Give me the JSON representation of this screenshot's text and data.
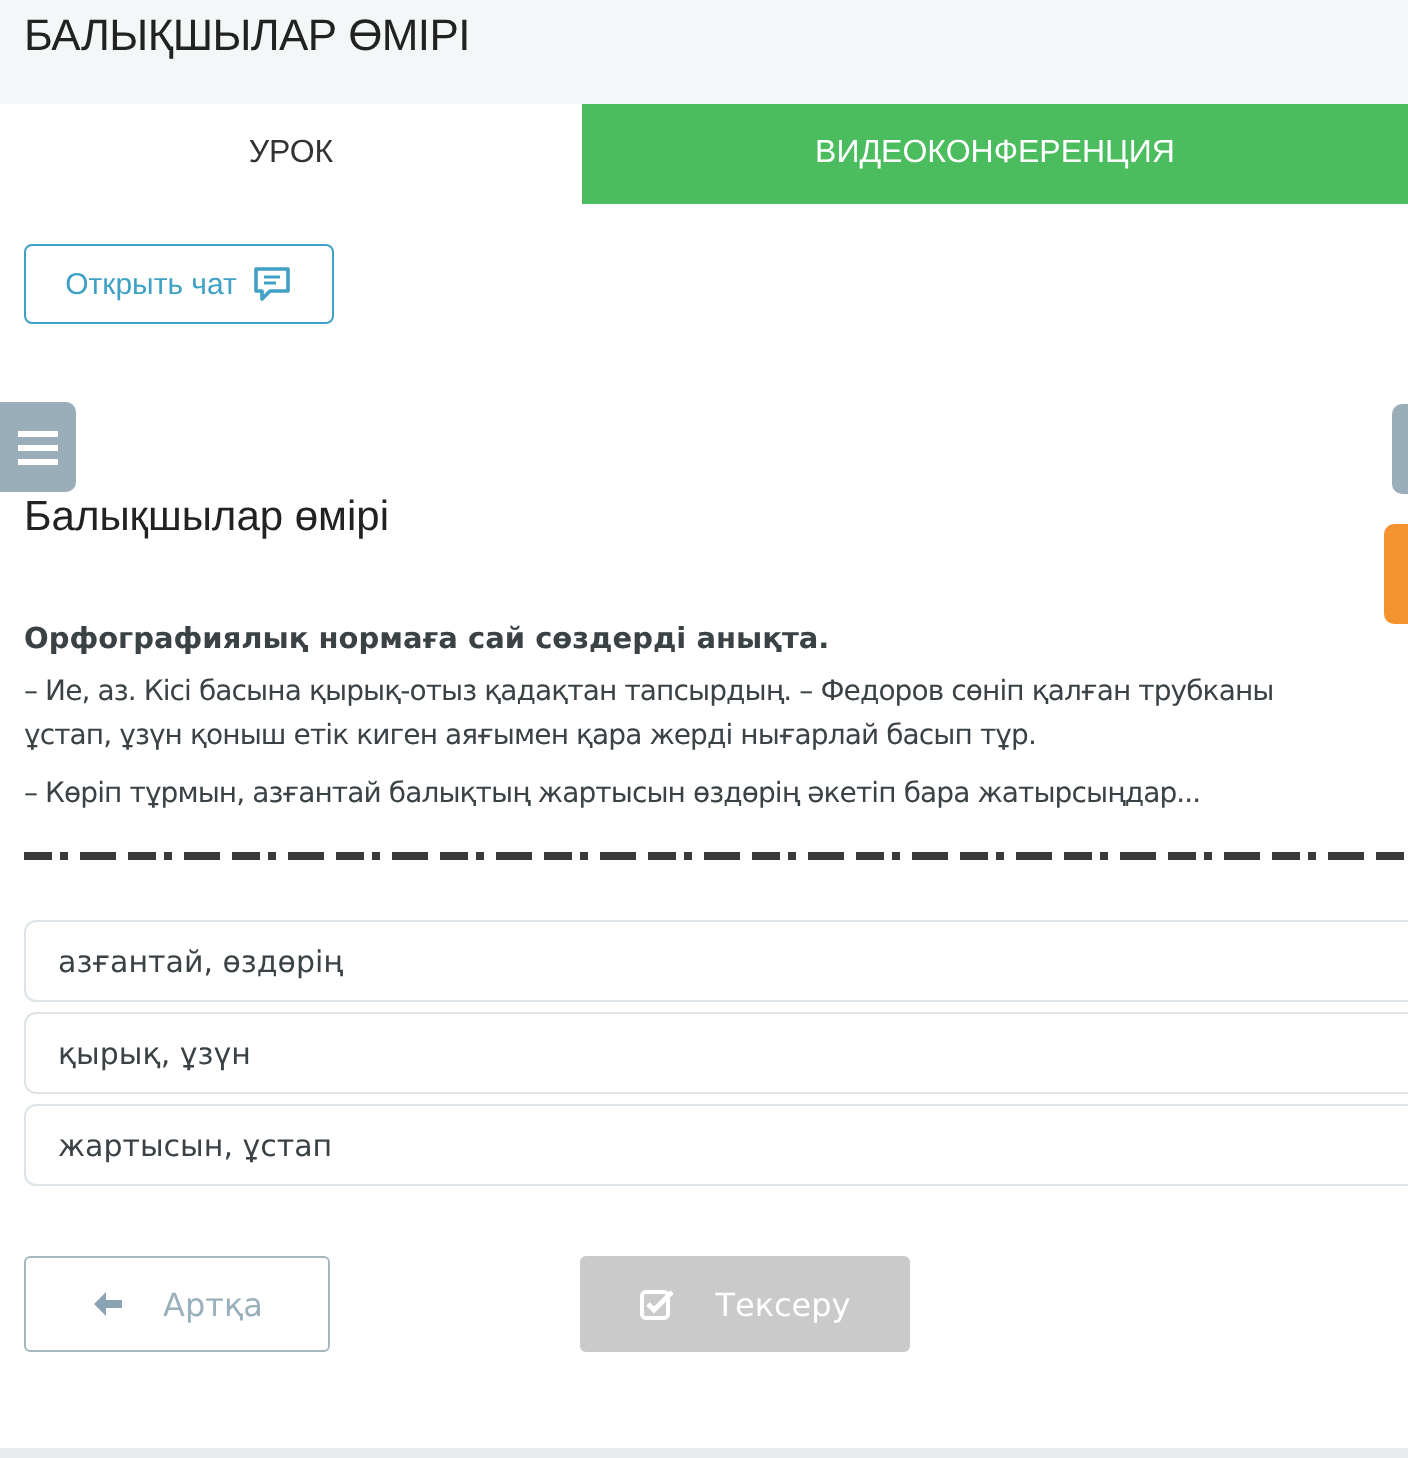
{
  "header": {
    "title": "БАЛЫҚШЫЛАР ӨМІРІ"
  },
  "tabs": [
    {
      "label": "УРОК",
      "selected": true
    },
    {
      "label": "ВИДЕОКОНФЕРЕНЦИЯ",
      "selected": false
    }
  ],
  "chat_button": {
    "label": "Открыть чат"
  },
  "lesson": {
    "title": "Балықшылар өмірі",
    "question": "Орфографиялық нормаға сай сөздерді анықта.",
    "paragraphs": [
      "– Ие, аз. Кісі басына қырық-отыз қадақтан тапсырдың. – Федоров сөніп қалған трубканы\nұстап, ұзүн қоныш етік киген аяғымен қара жерді нығарлай басып тұр.",
      "– Көріп тұрмын, азғантай балықтың жартысын өздөрің әкетіп бара жатырсыңдар..."
    ]
  },
  "options": [
    {
      "label": "азғантай, өздөрің",
      "selected": false
    },
    {
      "label": "қырық, ұзүн",
      "selected": false
    },
    {
      "label": "жартысын, ұстап",
      "selected": false
    }
  ],
  "buttons": [
    {
      "label": "Артқа",
      "kind": "back",
      "disabled": false
    },
    {
      "label": "Тексеру",
      "kind": "check",
      "disabled": true
    }
  ]
}
